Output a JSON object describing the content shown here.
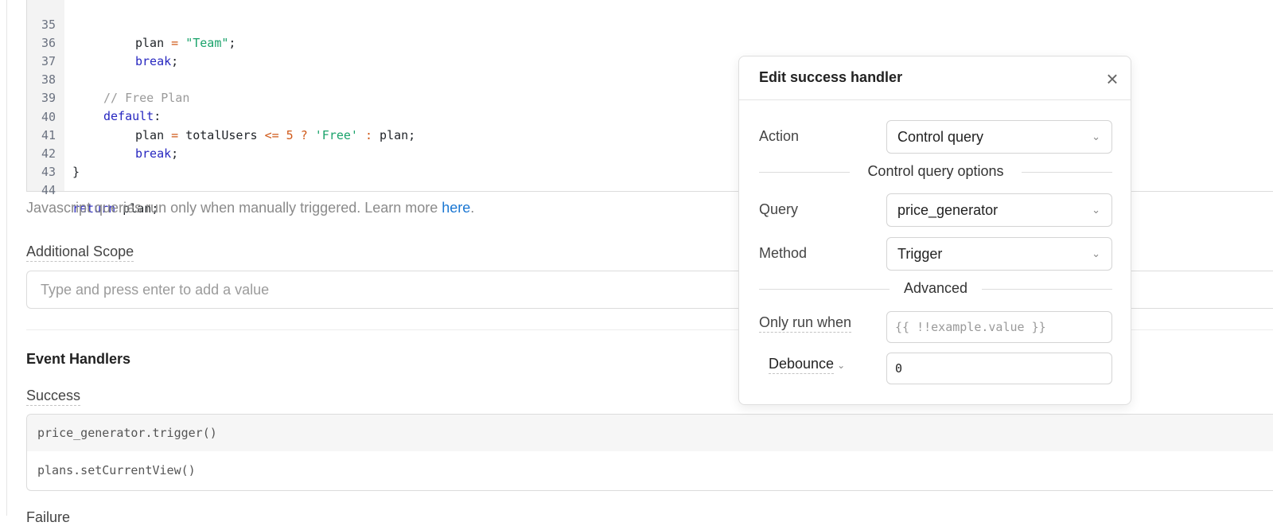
{
  "code": {
    "lines": [
      {
        "n": "35"
      },
      {
        "n": "36"
      },
      {
        "n": "37"
      },
      {
        "n": "38"
      },
      {
        "n": "39"
      },
      {
        "n": "40"
      },
      {
        "n": "41"
      },
      {
        "n": "42"
      },
      {
        "n": "43"
      },
      {
        "n": "44"
      }
    ],
    "tokens": {
      "l35_plan": "plan ",
      "l35_eq": "=",
      "l35_str": " \"Team\"",
      "l35_end": ";",
      "l36_break": "break",
      "l36_end": ";",
      "l38_comment": "// Free Plan",
      "l39_default": "default",
      "l39_colon": ":",
      "l40_a": "plan ",
      "l40_eq": "=",
      "l40_b": " totalUsers ",
      "l40_le": "<=",
      "l40_sp": " ",
      "l40_5": "5",
      "l40_q": " ?",
      "l40_free": " 'Free'",
      "l40_colon": " :",
      "l40_c": " plan;",
      "l41_break": "break",
      "l41_end": ";",
      "l42_brace": "}",
      "l44_return": "return",
      "l44_rest": " plan;"
    }
  },
  "hint": {
    "text": "Javascript queries run only when manually triggered. Learn more ",
    "link": "here",
    "period": "."
  },
  "scope": {
    "label": "Additional Scope",
    "placeholder": "Type and press enter to add a value"
  },
  "event_handlers": {
    "title": "Event Handlers",
    "success_label": "Success",
    "items": [
      "price_generator.trigger()",
      "plans.setCurrentView()"
    ],
    "failure_label": "Failure"
  },
  "modal": {
    "title": "Edit success handler",
    "close_icon": "close-icon",
    "action_label": "Action",
    "action_value": "Control query",
    "section_options": "Control query options",
    "query_label": "Query",
    "query_value": "price_generator",
    "method_label": "Method",
    "method_value": "Trigger",
    "section_advanced": "Advanced",
    "only_run_label": "Only run when",
    "only_run_placeholder": "{{ !!example.value }}",
    "debounce_label": "Debounce",
    "debounce_value": "0"
  },
  "colors": {
    "keyword": "#2727c0",
    "string": "#1aa36b",
    "operator": "#d05a1a",
    "link": "#1976d2"
  }
}
